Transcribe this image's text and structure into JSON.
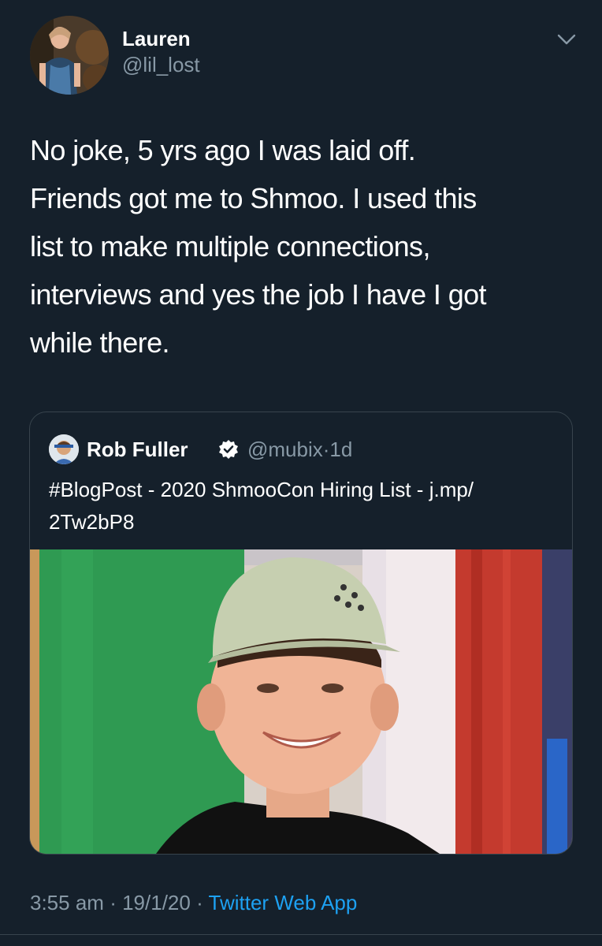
{
  "author": {
    "display_name": "Lauren",
    "handle": "@lil_lost",
    "avatar_icon": "profile-photo"
  },
  "tweet": {
    "text": "No joke, 5 yrs ago I was laid off.\nFriends got me to Shmoo. I used this\nlist to make multiple connections,\ninterviews and yes the job I have I got\nwhile there."
  },
  "quoted_tweet": {
    "display_name": "Rob Fuller",
    "verified": true,
    "handle": "@mubix",
    "age": "1d",
    "separator": "·",
    "text": "#BlogPost - 2020 ShmooCon Hiring List - j.mp/\n2Tw2bP8",
    "image_icon": "person-photo"
  },
  "meta": {
    "time": "3:55 am",
    "date": "19/1/20",
    "source": "Twitter Web App",
    "separator": "·"
  },
  "colors": {
    "background": "#15202b",
    "secondary_text": "#8899a6",
    "link": "#1da1f2",
    "border": "#38444d"
  }
}
